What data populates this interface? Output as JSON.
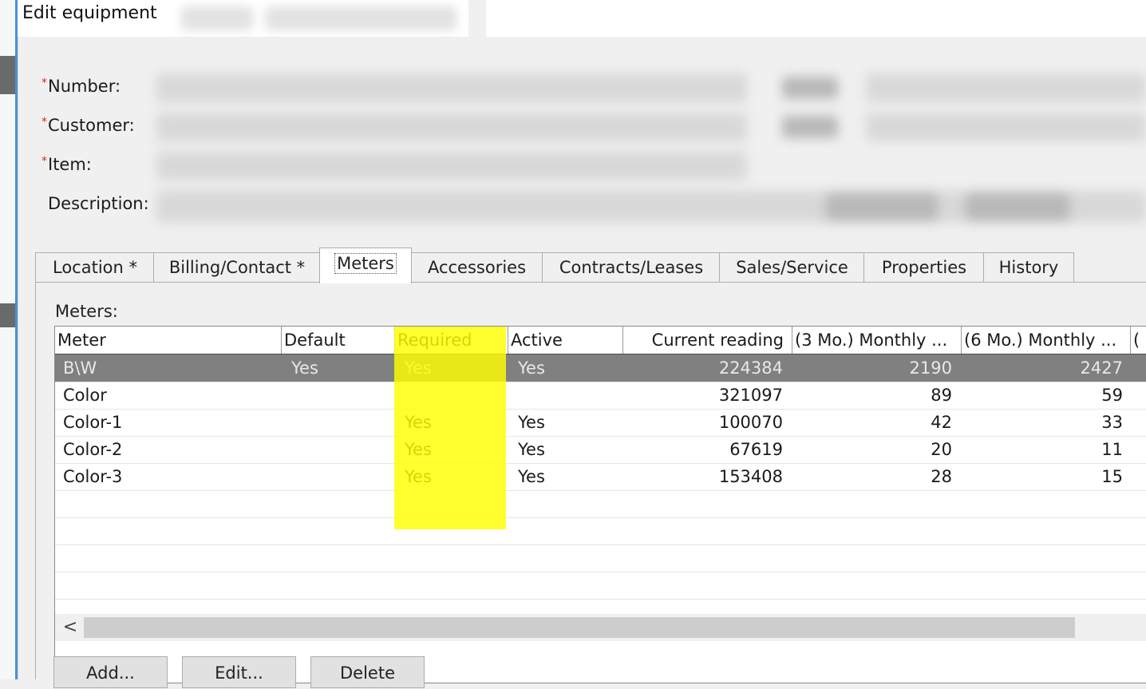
{
  "window": {
    "title": "Edit equipment"
  },
  "form": {
    "number_label": "Number:",
    "customer_label": "Customer:",
    "item_label": "Item:",
    "description_label": "Description:",
    "required_marker": "*"
  },
  "tabs": [
    {
      "label": "Location *",
      "active": false
    },
    {
      "label": "Billing/Contact *",
      "active": false
    },
    {
      "label": "Meters",
      "active": true
    },
    {
      "label": "Accessories",
      "active": false
    },
    {
      "label": "Contracts/Leases",
      "active": false
    },
    {
      "label": "Sales/Service",
      "active": false
    },
    {
      "label": "Properties",
      "active": false
    },
    {
      "label": "History",
      "active": false
    }
  ],
  "meters": {
    "section_label": "Meters:",
    "columns": [
      "Meter",
      "Default",
      "Required",
      "Active",
      "Current reading",
      "(3 Mo.) Monthly ...",
      "(6 Mo.) Monthly ..."
    ],
    "rows": [
      {
        "meter": "B\\W",
        "default": "Yes",
        "required": "Yes",
        "active": "Yes",
        "current": "224384",
        "m3": "2190",
        "m6": "2427",
        "selected": true
      },
      {
        "meter": "Color",
        "default": "",
        "required": "",
        "active": "",
        "current": "321097",
        "m3": "89",
        "m6": "59",
        "selected": false
      },
      {
        "meter": "Color-1",
        "default": "",
        "required": "Yes",
        "active": "Yes",
        "current": "100070",
        "m3": "42",
        "m6": "33",
        "selected": false
      },
      {
        "meter": "Color-2",
        "default": "",
        "required": "Yes",
        "active": "Yes",
        "current": "67619",
        "m3": "20",
        "m6": "11",
        "selected": false
      },
      {
        "meter": "Color-3",
        "default": "",
        "required": "Yes",
        "active": "Yes",
        "current": "153408",
        "m3": "28",
        "m6": "15",
        "selected": false
      }
    ],
    "scroll_left_glyph": "<"
  },
  "buttons": {
    "add": "Add...",
    "edit": "Edit...",
    "delete": "Delete"
  },
  "colors": {
    "highlight": "#ffff00",
    "selected_row": "#808080",
    "required_marker": "#dd2222"
  }
}
